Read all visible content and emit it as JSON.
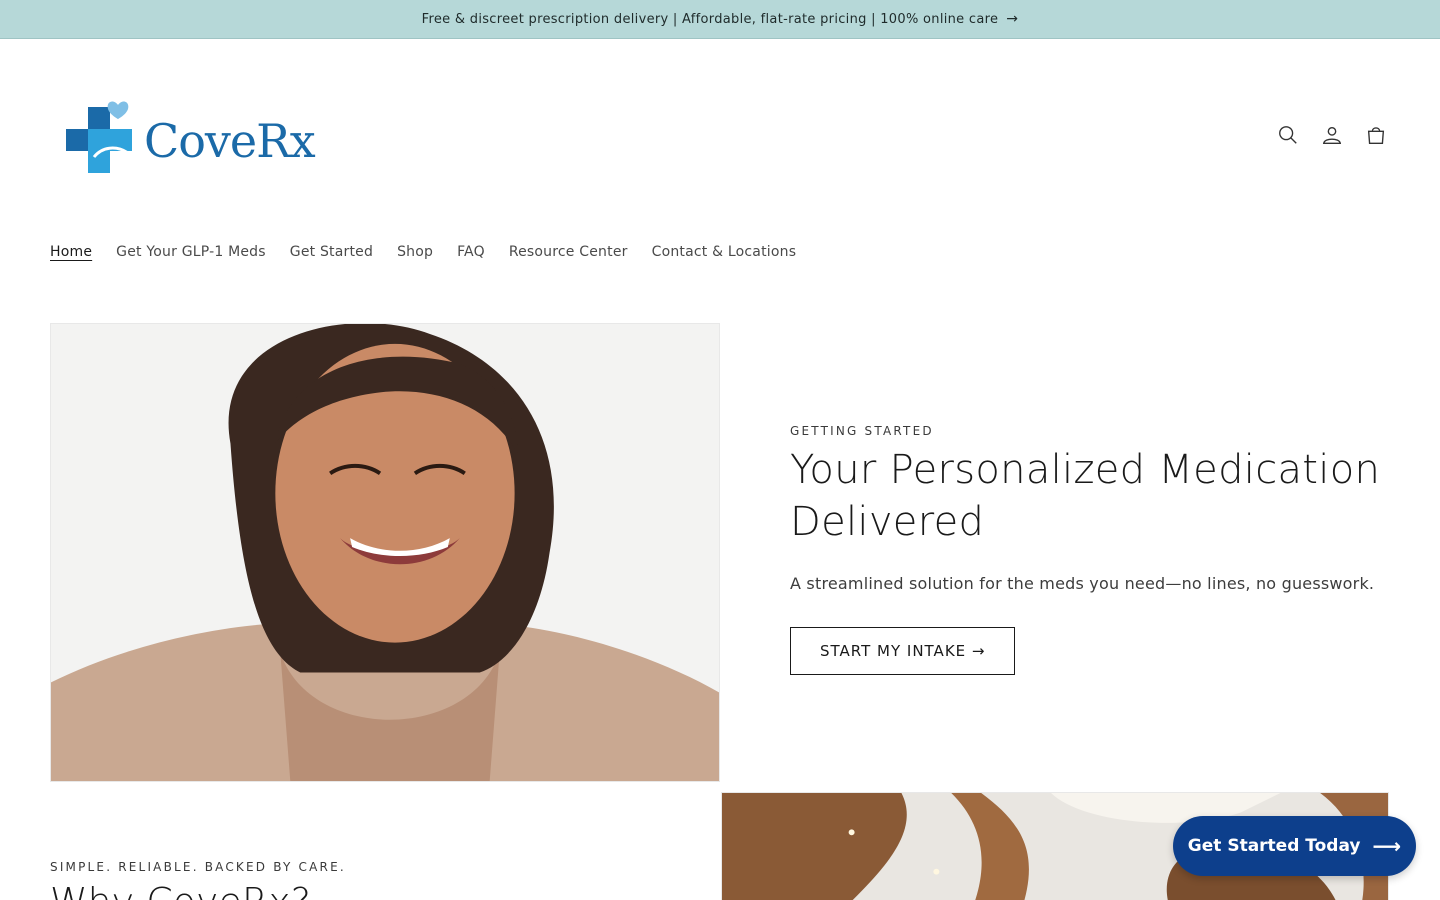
{
  "announcement": {
    "text": "Free & discreet prescription delivery | Affordable, flat-rate pricing | 100% online care",
    "arrow_icon": "arrow-right-icon"
  },
  "logo": {
    "text": "CoveRx",
    "icon": "cross-heart-logo-icon",
    "colors": {
      "primary": "#1b6aa8",
      "accent": "#2fa3dc"
    }
  },
  "header": {
    "icons": [
      "search-icon",
      "account-icon",
      "cart-icon"
    ]
  },
  "nav": {
    "items": [
      {
        "label": "Home",
        "active": true
      },
      {
        "label": "Get Your GLP-1 Meds"
      },
      {
        "label": "Get Started"
      },
      {
        "label": "Shop"
      },
      {
        "label": "FAQ"
      },
      {
        "label": "Resource Center"
      },
      {
        "label": "Contact & Locations"
      }
    ]
  },
  "hero": {
    "eyebrow": "GETTING STARTED",
    "title_line1": "Your Personalized Medication",
    "title_line2": "Delivered",
    "subtitle": "A streamlined solution for the meds you need—no lines, no guesswork.",
    "cta_label": "START MY INTAKE →"
  },
  "section2": {
    "eyebrow": "SIMPLE. RELIABLE. BACKED BY CARE.",
    "title": "Why CoveRx?"
  },
  "floating_cta": {
    "label": "Get Started Today",
    "arrow": "⟶",
    "color": "#0d3f8c"
  }
}
